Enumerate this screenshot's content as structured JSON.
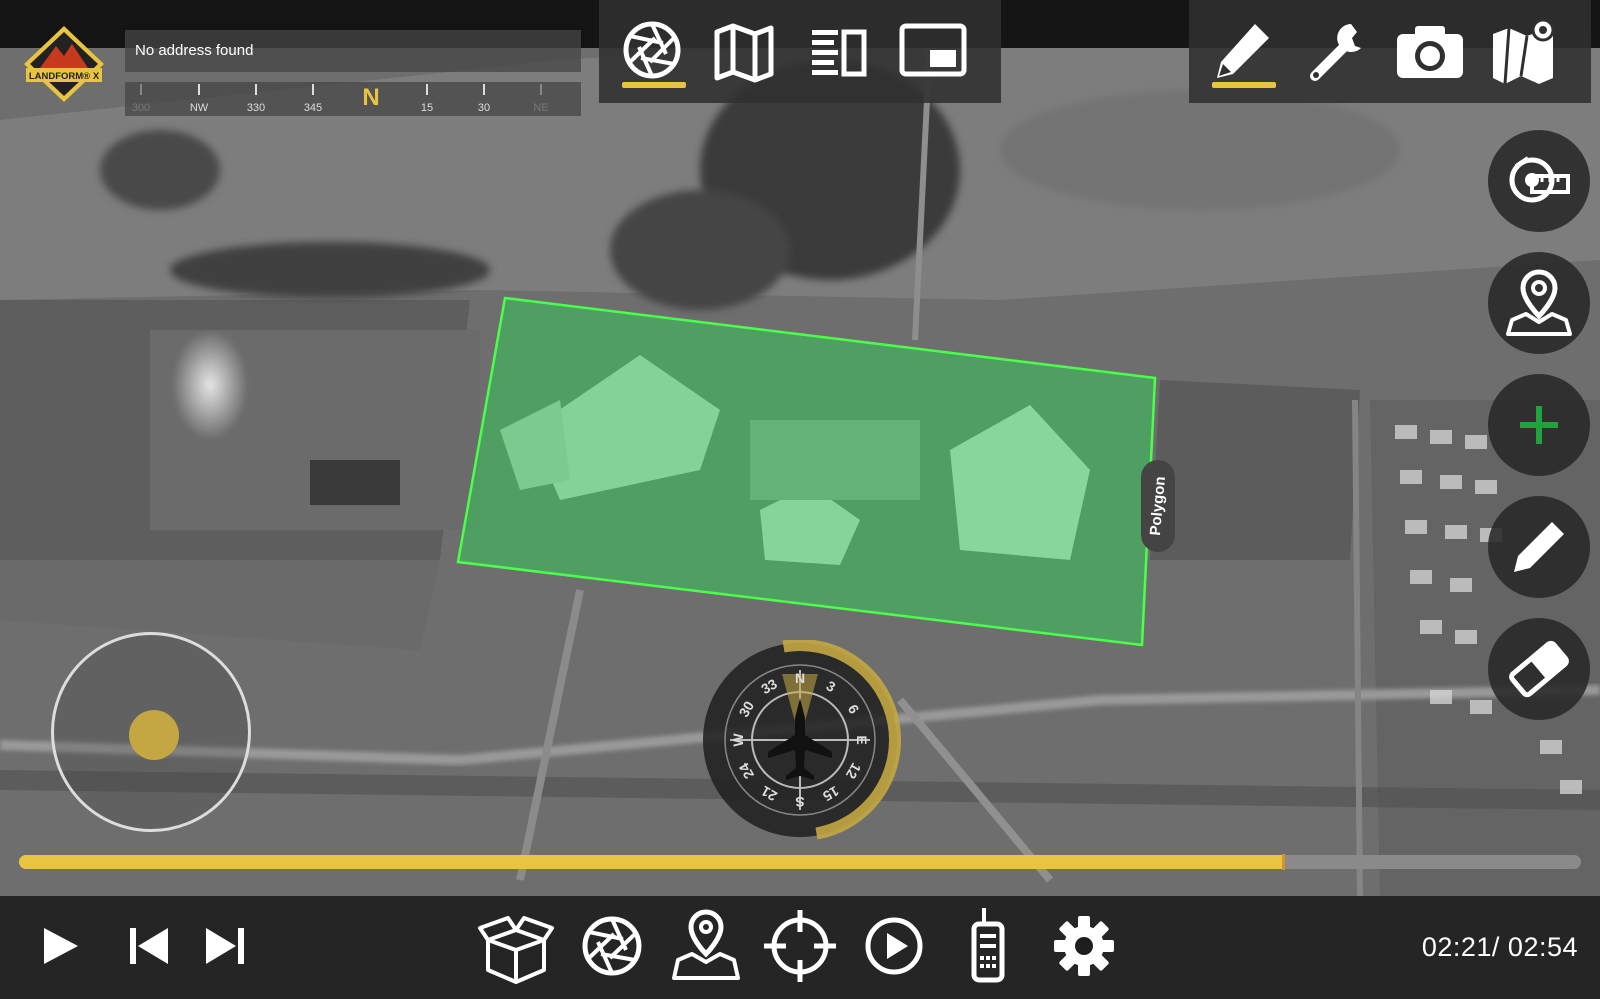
{
  "app": {
    "name": "LandForm X",
    "logo_text": "LANDFORM® X"
  },
  "colors": {
    "accent": "#e8c440",
    "polygon_fill": "#39c95a",
    "polygon_stroke": "#4cff4c",
    "progress_track": "#8a8a8a",
    "add_icon": "#1fa33a"
  },
  "address": {
    "text": "No address found"
  },
  "heading_tape": {
    "north_label": "N",
    "labels": [
      "300",
      "NW",
      "330",
      "345",
      "15",
      "30",
      "NE"
    ]
  },
  "top_tabs": [
    {
      "icon": "camera-aperture-icon",
      "active": true
    },
    {
      "icon": "map-icon",
      "active": false
    },
    {
      "icon": "list-view-icon",
      "active": false
    },
    {
      "icon": "picture-in-picture-icon",
      "active": false
    }
  ],
  "top_tools": [
    {
      "icon": "pencil-icon",
      "active": true
    },
    {
      "icon": "wrench-icon",
      "active": false
    },
    {
      "icon": "camera-icon",
      "active": false
    },
    {
      "icon": "map-pin-icon",
      "active": false
    }
  ],
  "side_tools": [
    {
      "icon": "measure-tape-icon"
    },
    {
      "icon": "map-marker-icon"
    },
    {
      "icon": "plus-icon"
    },
    {
      "icon": "pencil-icon"
    },
    {
      "icon": "eraser-icon"
    }
  ],
  "map": {
    "polygon_label": "Polygon"
  },
  "compass": {
    "labels": [
      "N",
      "3",
      "6",
      "E",
      "12",
      "15",
      "S",
      "21",
      "24",
      "W",
      "30",
      "33"
    ],
    "heading_deg": 0
  },
  "playback": {
    "current_time": "02:21",
    "total_time": "02:54",
    "progress": 0.81
  },
  "bottom_tools": [
    {
      "icon": "box-icon"
    },
    {
      "icon": "camera-aperture-icon"
    },
    {
      "icon": "map-marker-icon"
    },
    {
      "icon": "crosshair-icon"
    },
    {
      "icon": "play-circle-icon"
    },
    {
      "icon": "radio-icon"
    },
    {
      "icon": "settings-gear-icon"
    }
  ]
}
